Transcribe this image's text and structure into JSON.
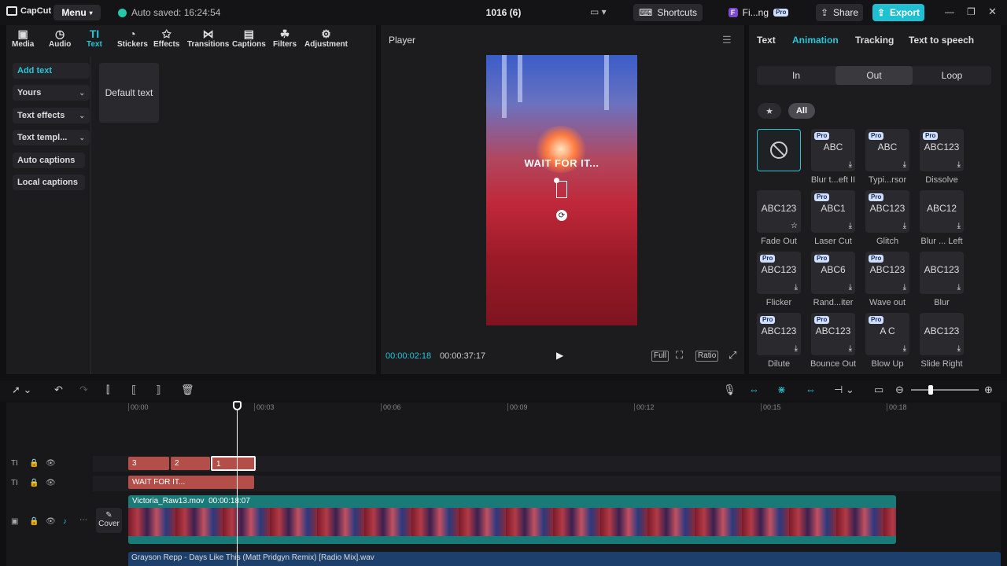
{
  "app": {
    "name": "CapCut",
    "menu_label": "Menu",
    "autosave": "Auto saved: 16:24:54",
    "project_title": "1016 (6)"
  },
  "topbar": {
    "shortcuts": "Shortcuts",
    "account": "Fi...ng",
    "pro_badge": "Pro",
    "share": "Share",
    "export": "Export"
  },
  "toolbar": {
    "items": [
      {
        "label": "Media",
        "icon": "media-icon"
      },
      {
        "label": "Audio",
        "icon": "audio-icon"
      },
      {
        "label": "Text",
        "icon": "text-icon"
      },
      {
        "label": "Stickers",
        "icon": "stickers-icon"
      },
      {
        "label": "Effects",
        "icon": "effects-icon"
      },
      {
        "label": "Transitions",
        "icon": "transitions-icon"
      },
      {
        "label": "Captions",
        "icon": "captions-icon"
      },
      {
        "label": "Filters",
        "icon": "filters-icon"
      },
      {
        "label": "Adjustment",
        "icon": "adjustment-icon"
      }
    ],
    "active": "Text"
  },
  "sidebar": {
    "items": [
      {
        "label": "Add text"
      },
      {
        "label": "Yours"
      },
      {
        "label": "Text effects"
      },
      {
        "label": "Text templ..."
      },
      {
        "label": "Auto captions"
      },
      {
        "label": "Local captions"
      }
    ]
  },
  "text_library": {
    "default_card": "Default text"
  },
  "player": {
    "title": "Player",
    "overlay_text": "WAIT FOR IT...",
    "current_time": "00:00:02:18",
    "total_time": "00:00:37:17",
    "full": "Full",
    "ratio": "Ratio"
  },
  "right_panel": {
    "tabs": [
      "Text",
      "Animation",
      "Tracking",
      "Text to speech"
    ],
    "active_tab": "Animation",
    "segments": [
      "In",
      "Out",
      "Loop"
    ],
    "active_segment": "Out",
    "filter_all": "All",
    "animations": [
      {
        "name": "",
        "preview": "",
        "pro": false
      },
      {
        "name": "Blur t...eft II",
        "preview": "ABC",
        "pro": true
      },
      {
        "name": "Typi...rsor",
        "preview": "ABC",
        "pro": true
      },
      {
        "name": "Dissolve",
        "preview": "ABC123",
        "pro": true
      },
      {
        "name": "Fade Out",
        "preview": "ABC123",
        "pro": false
      },
      {
        "name": "Laser Cut",
        "preview": "ABC1",
        "pro": true
      },
      {
        "name": "Glitch",
        "preview": "ABC123",
        "pro": true
      },
      {
        "name": "Blur ... Left",
        "preview": "ABC12",
        "pro": false
      },
      {
        "name": "Flicker",
        "preview": "ABC123",
        "pro": true
      },
      {
        "name": "Rand...iter",
        "preview": "ABC6",
        "pro": true
      },
      {
        "name": "Wave out",
        "preview": "ABC123",
        "pro": true
      },
      {
        "name": "Blur",
        "preview": "ABC123",
        "pro": false
      },
      {
        "name": "Dilute",
        "preview": "ABC123",
        "pro": true
      },
      {
        "name": "Bounce Out",
        "preview": "ABC123",
        "pro": true
      },
      {
        "name": "Blow Up",
        "preview": "A C",
        "pro": true
      },
      {
        "name": "Slide Right",
        "preview": "ABC123",
        "pro": false
      }
    ]
  },
  "timeline": {
    "ruler": [
      "00:00",
      "00:03",
      "00:06",
      "00:09",
      "00:12",
      "00:15",
      "00:18"
    ],
    "text_clips_top": [
      "3",
      "2",
      "1"
    ],
    "text_clip": "WAIT FOR IT...",
    "video_clip": {
      "name": "Victoria_Raw13.mov",
      "duration": "00:00:18:07"
    },
    "cover_label": "Cover",
    "audio_clip": "Grayson Repp - Days Like This (Matt Pridgyn Remix) [Radio Mix].wav"
  }
}
